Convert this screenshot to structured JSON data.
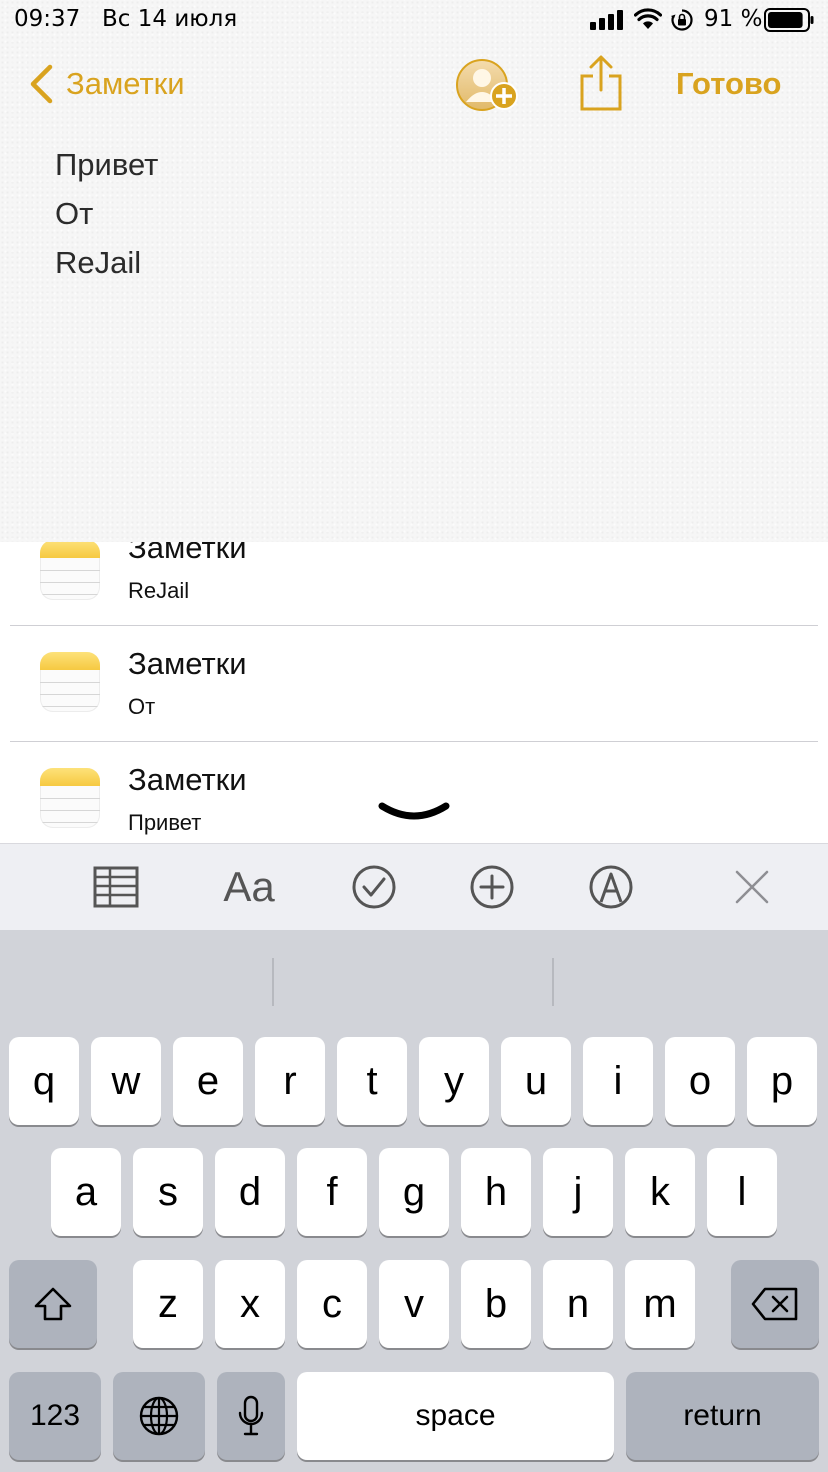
{
  "status_bar": {
    "time": "09:37",
    "date": "Вс 14 июля",
    "battery_percent": "91 %",
    "battery_level": 0.91,
    "icons": [
      "cellular-signal-icon",
      "wifi-icon",
      "orientation-lock-icon",
      "battery-icon"
    ]
  },
  "nav": {
    "back_label": "Заметки",
    "done_label": "Готово",
    "accent_color": "#d9a31f",
    "icons": [
      "chevron-left-icon",
      "add-person-icon",
      "share-icon"
    ]
  },
  "note": {
    "lines": [
      "Привет",
      "От",
      "ReJail"
    ]
  },
  "suggestions": [
    {
      "title": "Заметки",
      "subtitle": "ReJail"
    },
    {
      "title": "Заметки",
      "subtitle": "От"
    },
    {
      "title": "Заметки",
      "subtitle": "Привет"
    }
  ],
  "toolbar": {
    "format_label": "Aa",
    "icons": [
      "table-icon",
      "text-format-icon",
      "checklist-icon",
      "add-icon",
      "markup-pen-icon",
      "close-icon"
    ]
  },
  "keyboard": {
    "row1": [
      "q",
      "w",
      "e",
      "r",
      "t",
      "y",
      "u",
      "i",
      "o",
      "p"
    ],
    "row2": [
      "a",
      "s",
      "d",
      "f",
      "g",
      "h",
      "j",
      "k",
      "l"
    ],
    "row3": [
      "z",
      "x",
      "c",
      "v",
      "b",
      "n",
      "m"
    ],
    "numbers_label": "123",
    "space_label": "space",
    "return_label": "return",
    "icons": [
      "shift-icon",
      "backspace-icon",
      "globe-icon",
      "microphone-icon"
    ]
  }
}
